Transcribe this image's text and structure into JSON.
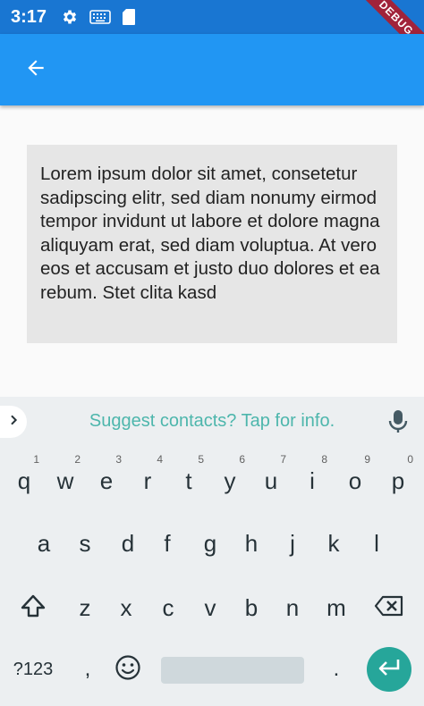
{
  "status_bar": {
    "time": "3:17",
    "icons": [
      "gear-icon",
      "keyboard-icon",
      "sd-card-icon"
    ],
    "debug_banner": "DEBUG"
  },
  "app_bar": {
    "back_icon": "arrow-back-icon",
    "color": "#2196f3"
  },
  "content": {
    "text": "Lorem ipsum dolor sit amet, consetetur sadipscing elitr, sed diam nonumy eirmod tempor invidunt ut labore et dolore magna aliquyam erat, sed diam voluptua. At vero eos et accusam et justo duo dolores et ea rebum. Stet clita kasd"
  },
  "keyboard": {
    "suggestion": "Suggest contacts? Tap for info.",
    "row1": [
      {
        "key": "q",
        "hint": "1"
      },
      {
        "key": "w",
        "hint": "2"
      },
      {
        "key": "e",
        "hint": "3"
      },
      {
        "key": "r",
        "hint": "4"
      },
      {
        "key": "t",
        "hint": "5"
      },
      {
        "key": "y",
        "hint": "6"
      },
      {
        "key": "u",
        "hint": "7"
      },
      {
        "key": "i",
        "hint": "8"
      },
      {
        "key": "o",
        "hint": "9"
      },
      {
        "key": "p",
        "hint": "0"
      }
    ],
    "row2": [
      "a",
      "s",
      "d",
      "f",
      "g",
      "h",
      "j",
      "k",
      "l"
    ],
    "row3": [
      "z",
      "x",
      "c",
      "v",
      "b",
      "n",
      "m"
    ],
    "symbols_label": "?123",
    "comma_label": ",",
    "period_label": ".",
    "accent_color": "#26a69a"
  }
}
